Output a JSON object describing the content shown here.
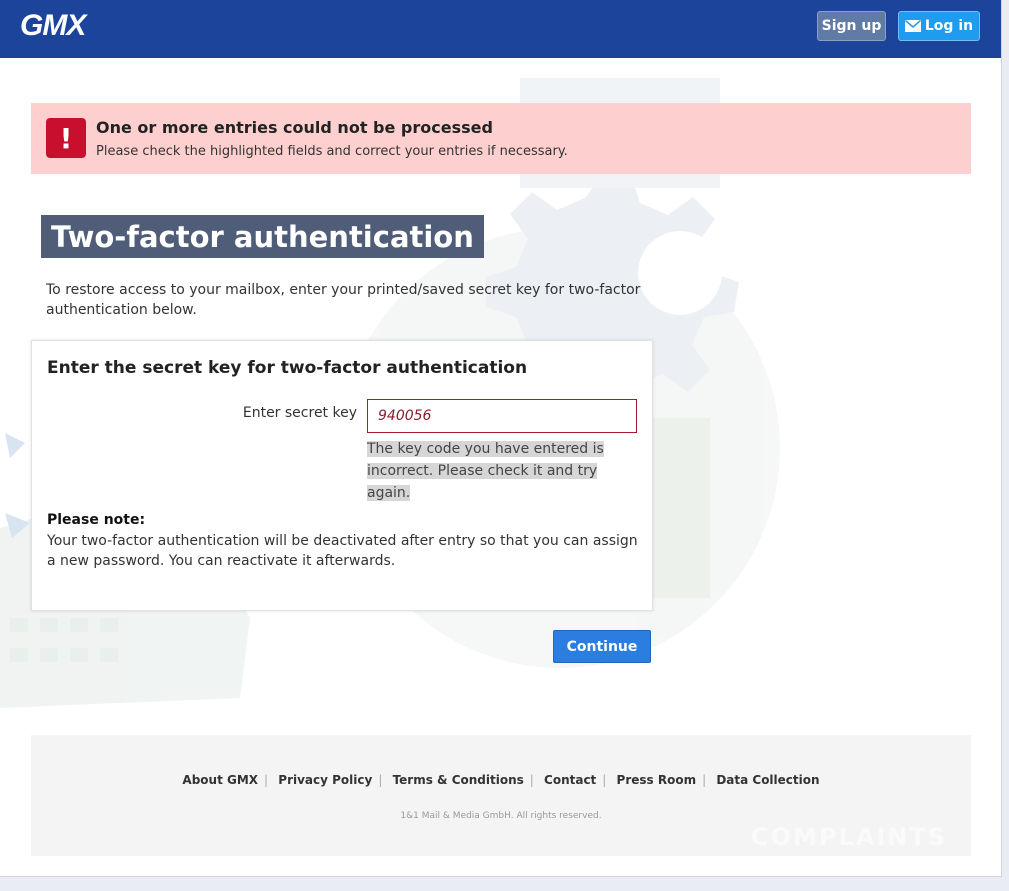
{
  "header": {
    "logo": "GMX",
    "signup_label": "Sign up",
    "login_label": "Log in"
  },
  "alert": {
    "title": "One or more entries could not be processed",
    "text": "Please check the highlighted fields and correct your entries if necessary.",
    "icon_glyph": "!"
  },
  "main": {
    "title": "Two-factor authentication",
    "intro": "To restore access to your mailbox, enter your printed/saved secret key for two-factor authentication below."
  },
  "card": {
    "title": "Enter the secret key for two-factor authentication",
    "field_label": "Enter secret key",
    "field_value": "940056",
    "error": "The key code you have entered is incorrect. Please check it and try again.",
    "note_title": "Please note:",
    "note_text": "Your two-factor authentication will be deactivated after entry so that you can assign a new password. You can reactivate it afterwards."
  },
  "actions": {
    "continue_label": "Continue"
  },
  "footer": {
    "links": [
      "About GMX",
      "Privacy Policy",
      "Terms & Conditions",
      "Contact",
      "Press Room",
      "Data Collection"
    ],
    "copyright": "1&1 Mail & Media GmbH. All rights reserved.",
    "watermark": "COMPLAINTS"
  },
  "colors": {
    "header_bg": "#1c449b",
    "alert_bg": "#fdcfcf",
    "alert_icon": "#c8102e",
    "title_bg": "#4f5d78",
    "continue_bg": "#2b7de0",
    "login_bg": "#1f9bf0",
    "signup_bg": "#607ba6",
    "error_border": "#a8192e"
  }
}
